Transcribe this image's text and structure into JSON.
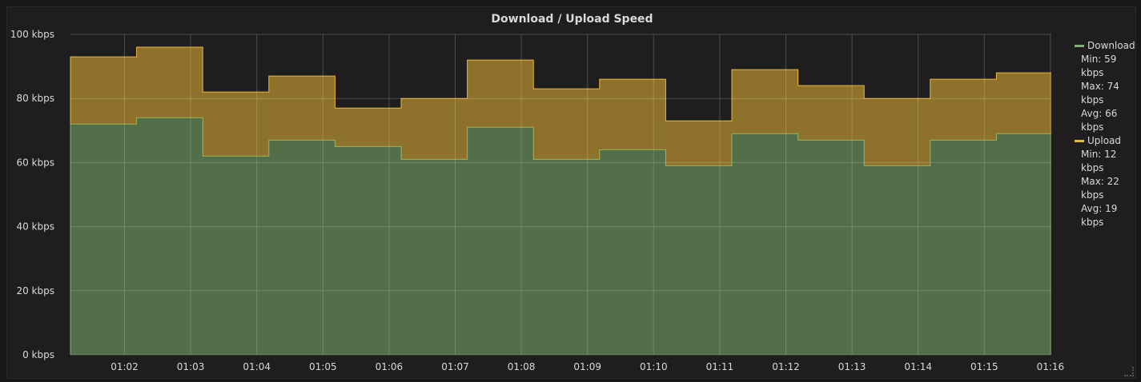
{
  "chart_data": {
    "type": "area",
    "stacked": true,
    "step": true,
    "title": "Download / Upload Speed",
    "x_ticks": [
      "01:02",
      "01:03",
      "01:04",
      "01:05",
      "01:06",
      "01:07",
      "01:08",
      "01:09",
      "01:10",
      "01:11",
      "01:12",
      "01:13",
      "01:14",
      "01:15",
      "01:16"
    ],
    "y_ticks": [
      "0 kbps",
      "20 kbps",
      "40 kbps",
      "60 kbps",
      "80 kbps",
      "100 kbps"
    ],
    "ylim": [
      0,
      100
    ],
    "grid": true,
    "legend_position": "right",
    "series": [
      {
        "name": "Download",
        "color": "#7eb26d",
        "values": [
          72,
          74,
          62,
          67,
          65,
          61,
          71,
          61,
          64,
          59,
          69,
          67,
          59,
          67,
          69
        ],
        "stats": {
          "min": "Min: 59 kbps",
          "max": "Max: 74 kbps",
          "avg": "Avg: 66 kbps"
        }
      },
      {
        "name": "Upload",
        "color": "#eab839",
        "values": [
          21,
          22,
          20,
          20,
          12,
          19,
          21,
          22,
          22,
          14,
          20,
          17,
          21,
          19,
          19
        ],
        "stats": {
          "min": "Min: 12 kbps",
          "max": "Max: 22 kbps",
          "avg": "Avg: 19 kbps"
        }
      }
    ]
  }
}
